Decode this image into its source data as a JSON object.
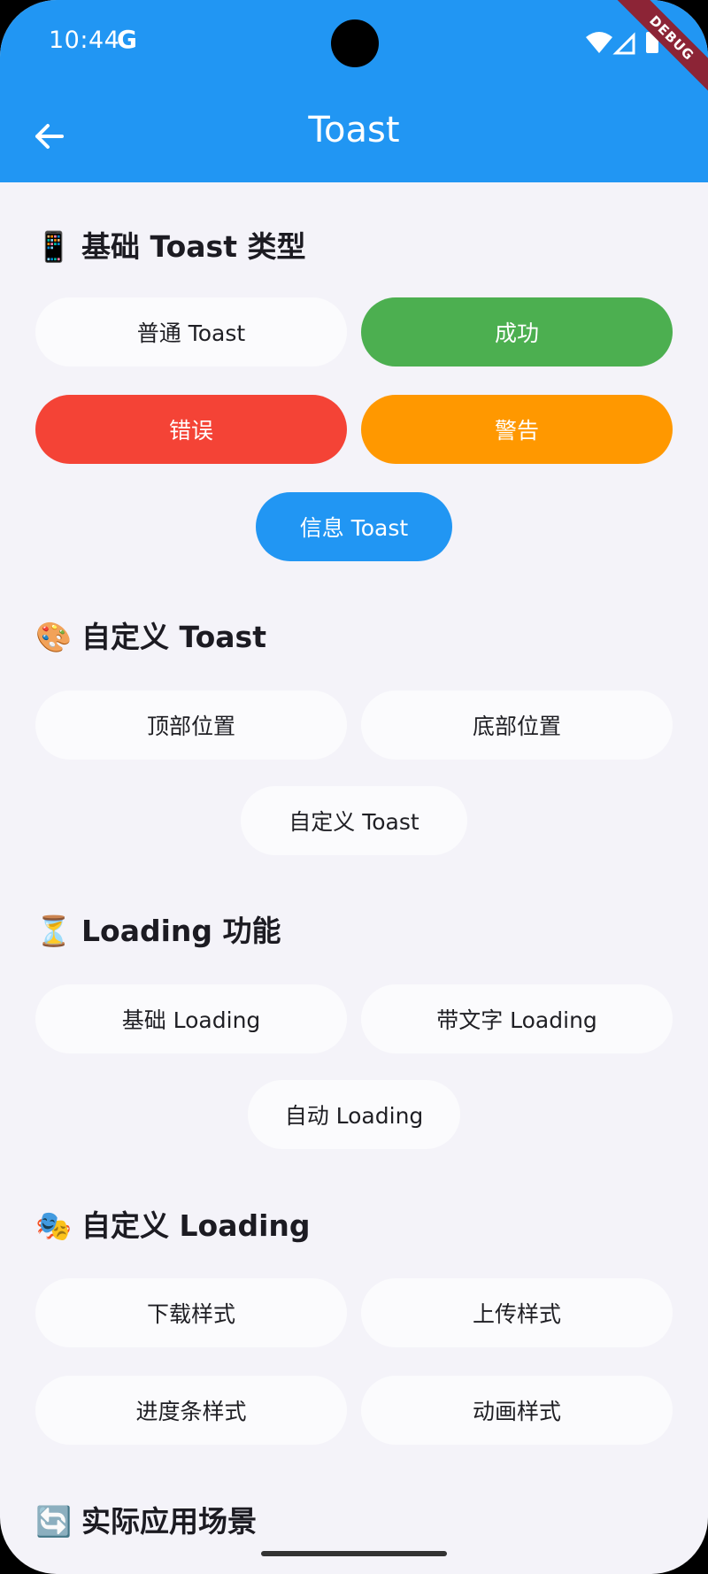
{
  "status_bar": {
    "time": "10:44",
    "g_label": "G",
    "debug_label": "DEBUG"
  },
  "app_bar": {
    "title": "Toast"
  },
  "sections": {
    "basic": {
      "emoji": "📱",
      "title": "基础 Toast 类型",
      "buttons": {
        "normal": "普通 Toast",
        "success": "成功",
        "error": "错误",
        "warning": "警告",
        "info": "信息 Toast"
      }
    },
    "custom_toast": {
      "emoji": "🎨",
      "title": "自定义 Toast",
      "buttons": {
        "top": "顶部位置",
        "bottom": "底部位置",
        "custom": "自定义 Toast"
      }
    },
    "loading": {
      "emoji": "⏳",
      "title": "Loading 功能",
      "buttons": {
        "basic": "基础 Loading",
        "with_text": "带文字 Loading",
        "auto": "自动 Loading"
      }
    },
    "custom_loading": {
      "emoji": "🎭",
      "title": "自定义 Loading",
      "buttons": {
        "download": "下载样式",
        "upload": "上传样式",
        "progress": "进度条样式",
        "animation": "动画样式"
      }
    },
    "scenarios": {
      "emoji": "🔄",
      "title": "实际应用场景"
    }
  },
  "colors": {
    "app_bar": "#2196f3",
    "success": "#4caf50",
    "error": "#f44336",
    "warning": "#ff9800",
    "info": "#2196f3"
  }
}
